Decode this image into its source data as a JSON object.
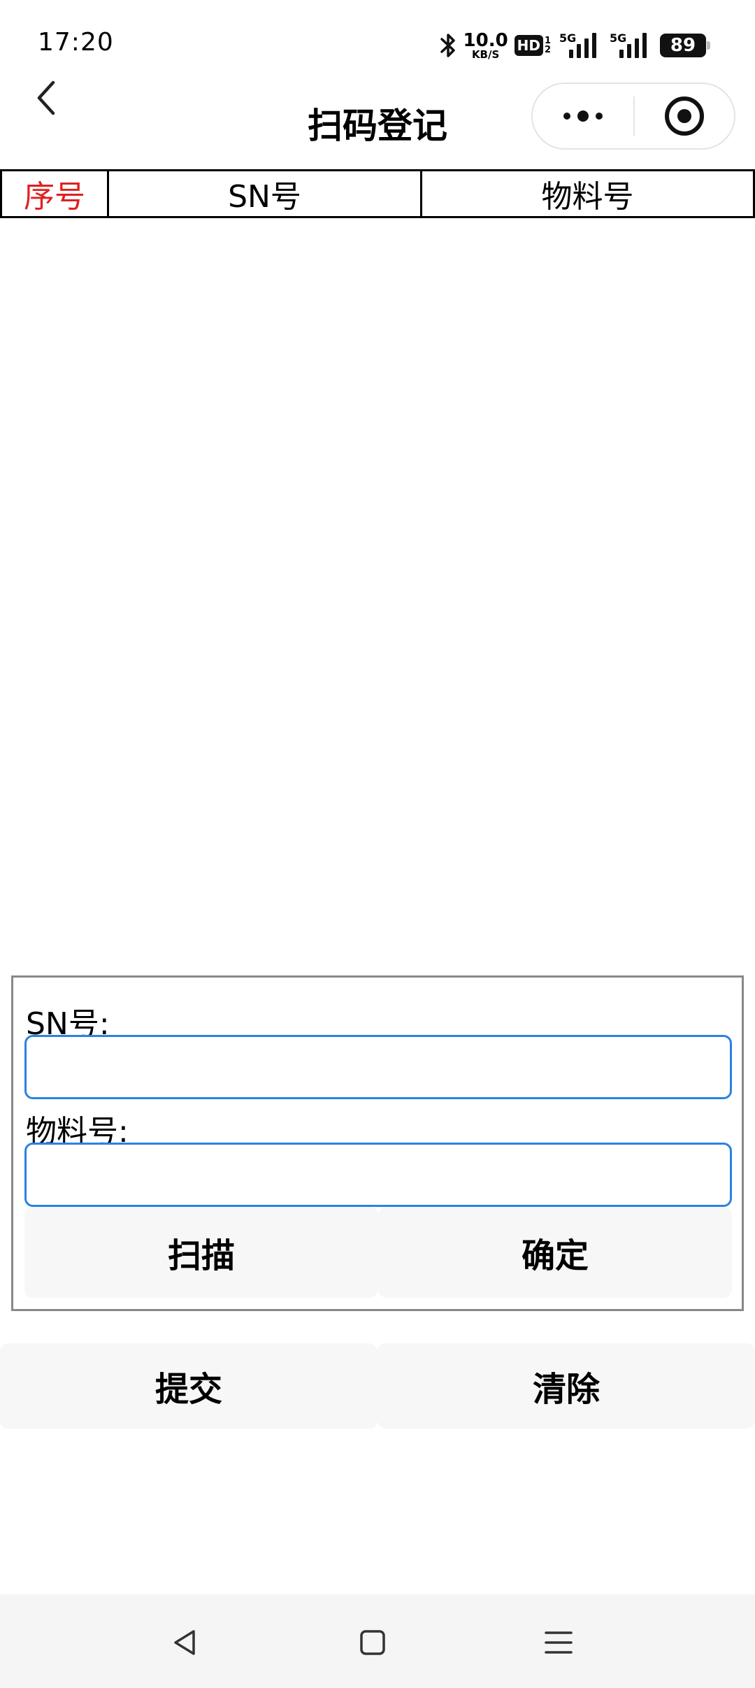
{
  "status_bar": {
    "time": "17:20",
    "net_speed_value": "10.0",
    "net_speed_unit": "KB/S",
    "hd_label": "HD",
    "hd_sub_top": "1",
    "hd_sub_bottom": "2",
    "signal1_label": "5G",
    "signal2_label": "5G",
    "battery": "89",
    "icons": [
      "bluetooth-icon",
      "signal-icon",
      "signal-icon",
      "battery-icon"
    ]
  },
  "nav": {
    "title": "扫码登记",
    "icons": [
      "back-chevron-icon",
      "more-dots-icon",
      "close-target-icon"
    ]
  },
  "table": {
    "columns": [
      "序号",
      "SN号",
      "物料号"
    ],
    "rows": [],
    "index_color": "#e02020"
  },
  "form": {
    "sn_label": "SN号:",
    "sn_value": "",
    "material_label": "物料号:",
    "material_value": "",
    "scan_button": "扫描",
    "confirm_button": "确定",
    "input_border_color": "#2a82e4"
  },
  "actions": {
    "submit_button": "提交",
    "clear_button": "清除"
  },
  "system_nav": {
    "icons": [
      "back-triangle-icon",
      "home-square-icon",
      "menu-lines-icon"
    ]
  }
}
